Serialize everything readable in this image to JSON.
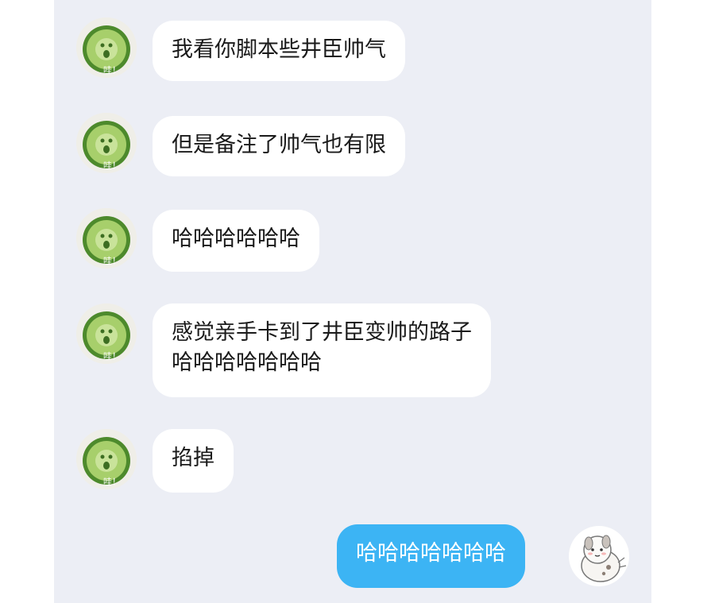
{
  "conversation": {
    "incoming": [
      {
        "lines": [
          "我看你脚本些井臣帅气"
        ]
      },
      {
        "lines": [
          "但是备注了帅气也有限"
        ]
      },
      {
        "lines": [
          "哈哈哈哈哈哈"
        ]
      },
      {
        "lines": [
          "感觉亲手卡到了井臣变帅的路子",
          "哈哈哈哈哈哈哈"
        ]
      },
      {
        "lines": [
          "掐掉"
        ]
      }
    ],
    "outgoing": [
      {
        "lines": [
          "哈哈哈哈哈哈哈"
        ]
      }
    ],
    "contact_avatar": {
      "icon": "cucumber-avatar-icon",
      "caption": "哇！"
    },
    "self_avatar": {
      "icon": "cartoon-dog-avatar-icon"
    }
  },
  "colors": {
    "background": "#eceef5",
    "incoming_bubble": "#ffffff",
    "outgoing_bubble": "#3cb4f4"
  }
}
